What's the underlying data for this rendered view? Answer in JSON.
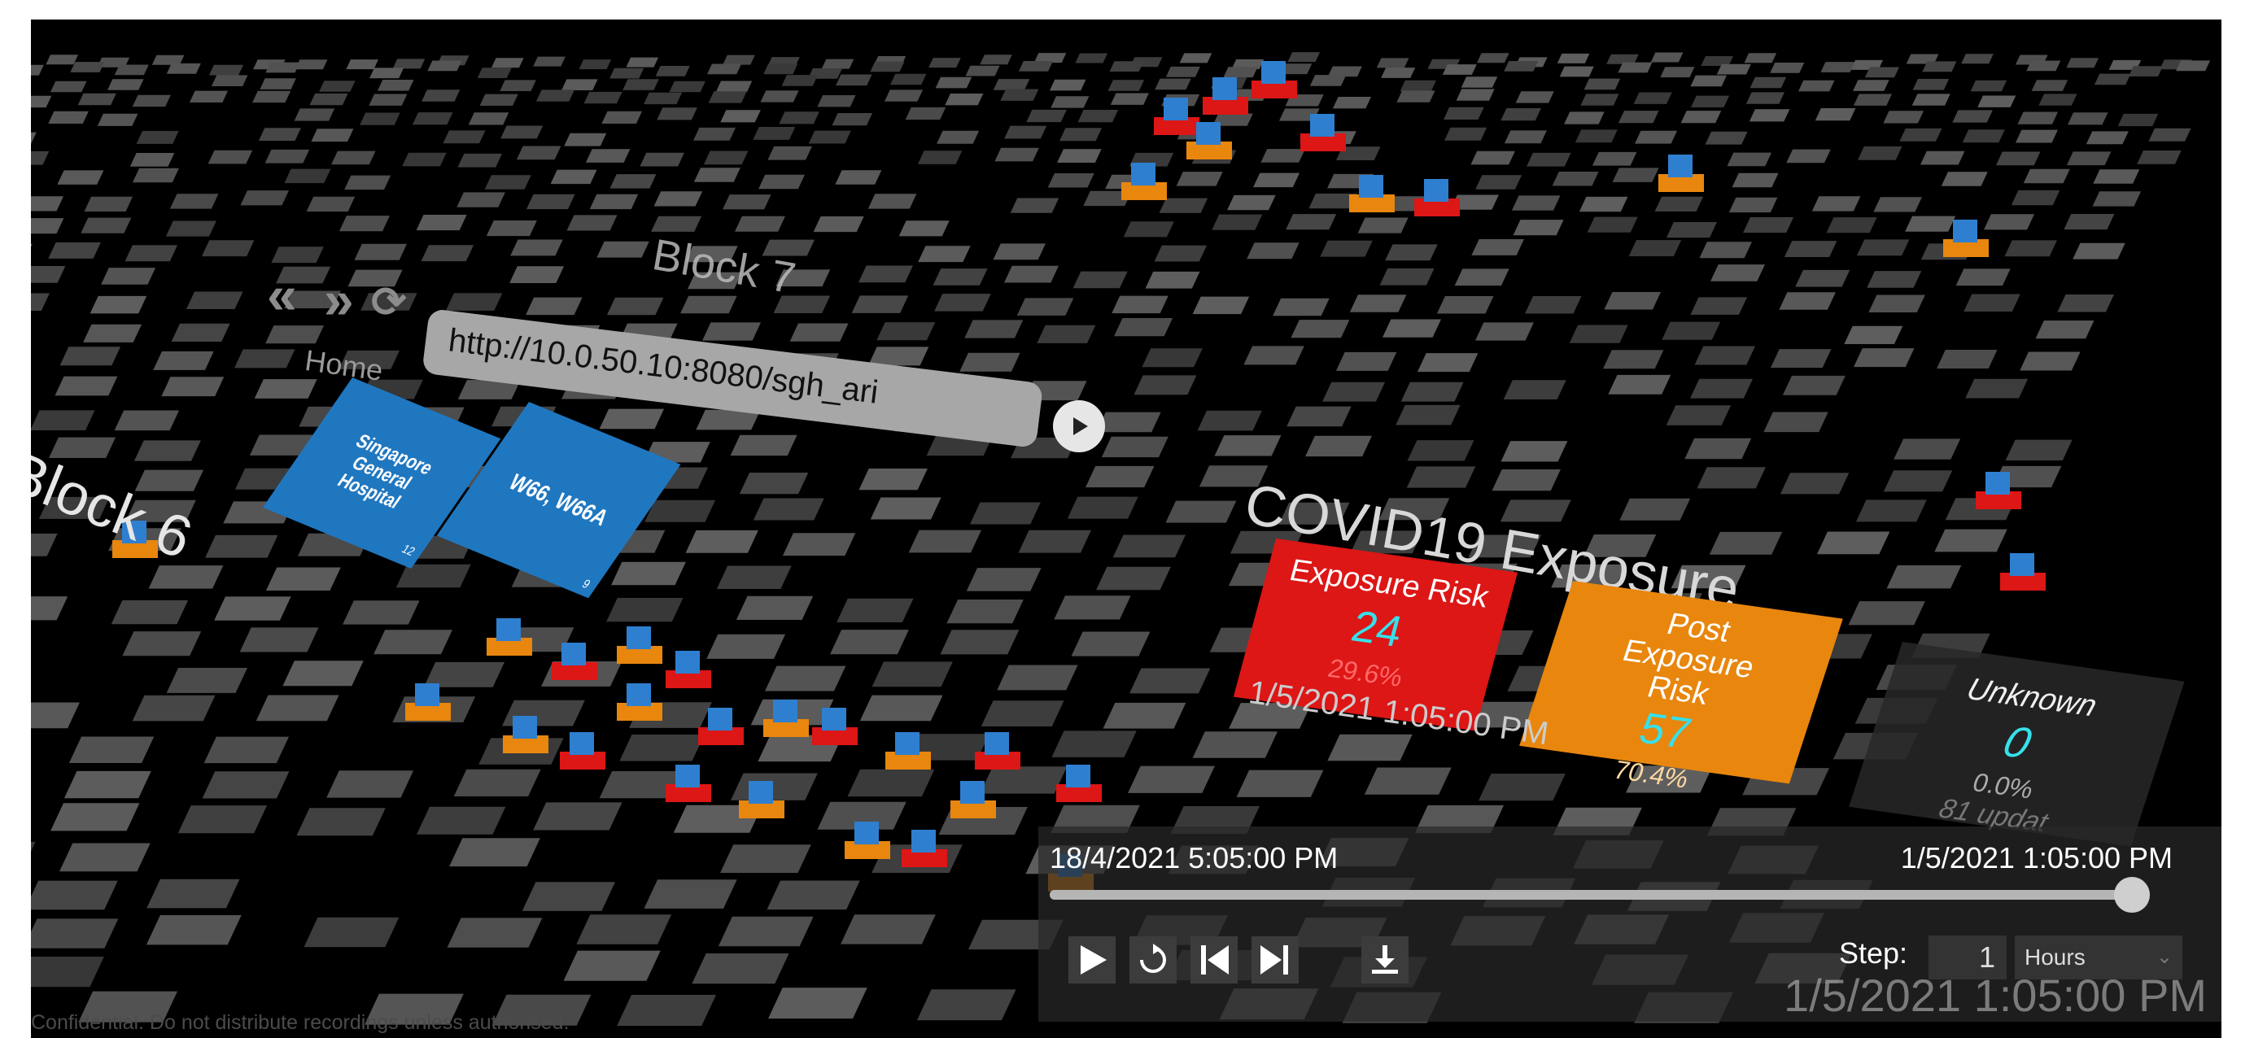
{
  "browser": {
    "back_glyph": "«",
    "forward_glyph": "»",
    "refresh_glyph": "⟳",
    "url": "http://10.0.50.10:8080/sgh_ari",
    "home_label": "Home",
    "tiles": [
      {
        "label": "Singapore General Hospital",
        "index": "12"
      },
      {
        "label": "W66, W66A",
        "index": "9"
      }
    ]
  },
  "scene": {
    "block_labels": [
      "Block 7",
      "Block 6"
    ]
  },
  "covid": {
    "title": "COVID19 Exposure",
    "cards": [
      {
        "label": "Exposure Risk",
        "value": "24",
        "percent": "29.6%",
        "color": "#dd1616"
      },
      {
        "label": "Post Exposure Risk",
        "value": "57",
        "percent": "70.4%",
        "color": "#e8860e"
      },
      {
        "label": "Unknown",
        "value": "0",
        "percent": "0.0%",
        "color": "#282828"
      }
    ],
    "unknown_update_text": "81 updat",
    "timestamp": "1/5/2021 1:05:00 PM",
    "value_color": "#37e0ea"
  },
  "player": {
    "start_time": "18/4/2021 5:05:00 PM",
    "end_time": "1/5/2021 1:05:00 PM",
    "progress": 1.0,
    "step_label": "Step:",
    "step_value": "1",
    "step_unit": "Hours",
    "current_time": "1/5/2021 1:05:00 PM",
    "buttons": [
      "play-icon",
      "replay-icon",
      "skip-start-icon",
      "skip-end-icon",
      "download-icon"
    ]
  },
  "footer": {
    "note": "Confidential. Do not distribute recordings unless authorised."
  }
}
